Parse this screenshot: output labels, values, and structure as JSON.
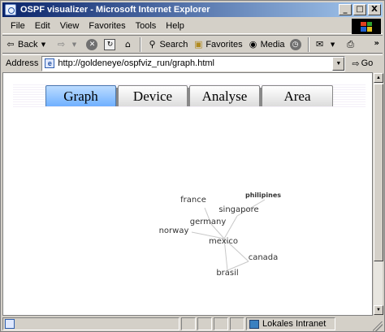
{
  "window": {
    "title": "OSPF visualizer - Microsoft Internet Explorer",
    "controls": {
      "minimize": "_",
      "maximize": "□",
      "close": "X"
    }
  },
  "menu": {
    "items": [
      "File",
      "Edit",
      "View",
      "Favorites",
      "Tools",
      "Help"
    ]
  },
  "toolbar": {
    "back_label": "Back",
    "search_label": "Search",
    "favorites_label": "Favorites",
    "media_label": "Media",
    "overflow": "»"
  },
  "address": {
    "label": "Address",
    "url": "http://goldeneye/ospfviz_run/graph.html",
    "go_label": "Go"
  },
  "page": {
    "tabs": [
      {
        "label": "Graph",
        "active": true
      },
      {
        "label": "Device",
        "active": false
      },
      {
        "label": "Analyse",
        "active": false
      },
      {
        "label": "Area",
        "active": false
      }
    ],
    "graph": {
      "nodes": [
        "france",
        "philipines",
        "singapore",
        "germany",
        "norway",
        "mexico",
        "canada",
        "brasil"
      ],
      "edges": [
        [
          "germany",
          "mexico"
        ],
        [
          "singapore",
          "mexico"
        ],
        [
          "philipines",
          "singapore"
        ],
        [
          "france",
          "germany"
        ],
        [
          "norway",
          "mexico"
        ],
        [
          "mexico",
          "canada"
        ],
        [
          "mexico",
          "brasil"
        ],
        [
          "canada",
          "brasil"
        ]
      ]
    }
  },
  "status": {
    "zone_label": "Lokales Intranet"
  },
  "colors": {
    "title_start": "#0a246a",
    "title_end": "#a6caf0",
    "active_tab": "#6fb0ff",
    "chrome": "#d4d0c8"
  }
}
